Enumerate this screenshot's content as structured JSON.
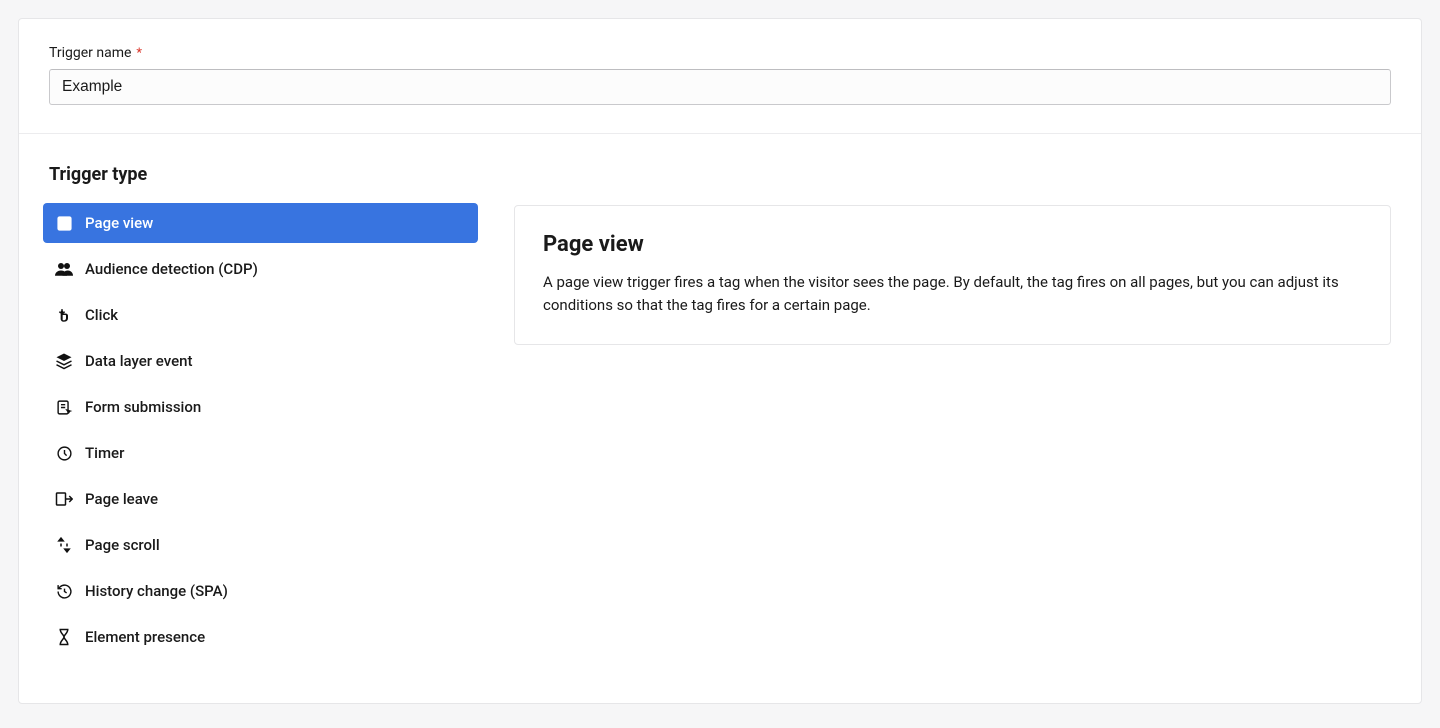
{
  "form": {
    "triggerName": {
      "label": "Trigger name",
      "required": "*",
      "value": "Example"
    }
  },
  "typeSection": {
    "heading": "Trigger type",
    "types": [
      {
        "label": "Page view",
        "icon": "page-view-icon",
        "selected": true
      },
      {
        "label": "Audience detection (CDP)",
        "icon": "audience-icon",
        "selected": false
      },
      {
        "label": "Click",
        "icon": "click-icon",
        "selected": false
      },
      {
        "label": "Data layer event",
        "icon": "layers-icon",
        "selected": false
      },
      {
        "label": "Form submission",
        "icon": "form-submit-icon",
        "selected": false
      },
      {
        "label": "Timer",
        "icon": "clock-icon",
        "selected": false
      },
      {
        "label": "Page leave",
        "icon": "exit-icon",
        "selected": false
      },
      {
        "label": "Page scroll",
        "icon": "scroll-icon",
        "selected": false
      },
      {
        "label": "History change (SPA)",
        "icon": "history-icon",
        "selected": false
      },
      {
        "label": "Element presence",
        "icon": "hourglass-icon",
        "selected": false
      }
    ]
  },
  "detail": {
    "title": "Page view",
    "description": "A page view trigger fires a tag when the visitor sees the page. By default, the tag fires on all pages, but you can adjust its conditions so that the tag fires for a certain page."
  }
}
